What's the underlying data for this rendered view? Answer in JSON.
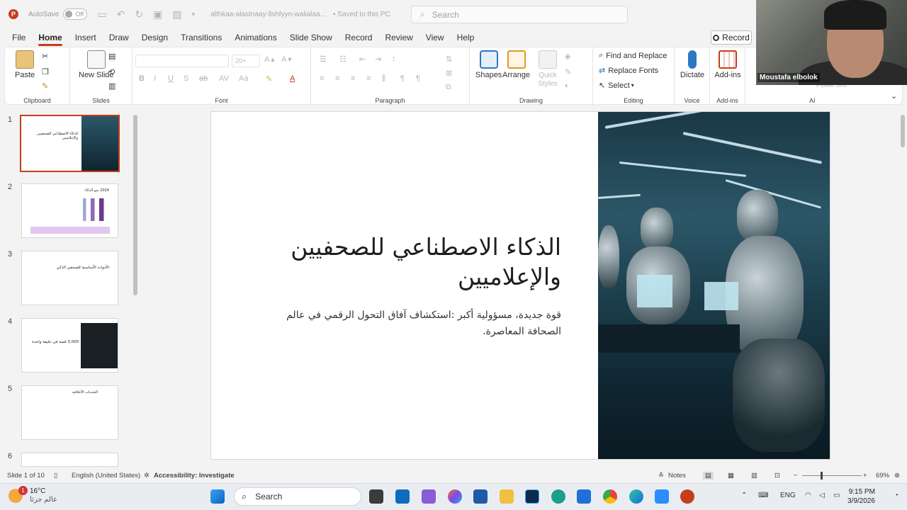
{
  "titlebar": {
    "autosave_label": "AutoSave",
    "autosave_state": "Off",
    "document_name": "althkaa-alastnaay-llshfyyn-walialaa...",
    "saved_status": "• Saved to this PC",
    "search_placeholder": "Search"
  },
  "menu": {
    "tabs": [
      "File",
      "Home",
      "Insert",
      "Draw",
      "Design",
      "Transitions",
      "Animations",
      "Slide Show",
      "Record",
      "Review",
      "View",
      "Help"
    ],
    "active": "Home",
    "record_button": "Record"
  },
  "ribbon": {
    "clipboard": {
      "label": "Clipboard",
      "paste": "Paste"
    },
    "slides": {
      "label": "Slides",
      "new_slide": "New Slide"
    },
    "font": {
      "label": "Font",
      "size_placeholder": "20+"
    },
    "paragraph": {
      "label": "Paragraph"
    },
    "drawing": {
      "label": "Drawing",
      "shapes": "Shapes",
      "arrange": "Arrange",
      "quick_styles": "Quick Styles"
    },
    "editing": {
      "label": "Editing",
      "find_replace": "Find and Replace",
      "replace_fonts": "Replace Fonts",
      "select": "Select"
    },
    "voice": {
      "label": "Voice",
      "dictate": "Dictate"
    },
    "addins": {
      "label": "Add-ins",
      "addins_btn": "Add-ins"
    },
    "ai": {
      "label": "AI",
      "power": "Power omt"
    }
  },
  "thumbnails": [
    {
      "num": "1",
      "title": "الذكاء الاصطناعي للصحفيين والإعلاميين"
    },
    {
      "num": "2",
      "title": "2024 نمو الذكاء"
    },
    {
      "num": "3",
      "title": "الأدوات الأساسية للصحفي الذكي"
    },
    {
      "num": "4",
      "title": "3,000 قصة في دقيقة واحدة"
    },
    {
      "num": "5",
      "title": "التحديات الأخلاقية"
    },
    {
      "num": "6",
      "title": ""
    }
  ],
  "slide": {
    "title": "الذكاء الاصطناعي للصحفيين والإعلاميين",
    "subtitle": "قوة جديدة، مسؤولية أكبر :استكشاف آفاق التحول الرقمي في عالم الصحافة المعاصرة."
  },
  "statusbar": {
    "slide_count": "Slide 1 of 10",
    "language": "English (United States)",
    "accessibility": "Accessibility: Investigate",
    "notes": "Notes",
    "zoom": "69%"
  },
  "webcam": {
    "name": "Moustafa elbolok"
  },
  "taskbar": {
    "weather_temp": "16°C",
    "weather_desc": "عالم جرثا",
    "weather_badge": "1",
    "search": "Search",
    "lang": "ENG",
    "time": "9:15 PM",
    "date": "3/9/2026"
  },
  "colors": {
    "accent": "#c43e1c",
    "ribbon_bg": "#ffffff",
    "chrome_bg": "#f3f3f3"
  }
}
